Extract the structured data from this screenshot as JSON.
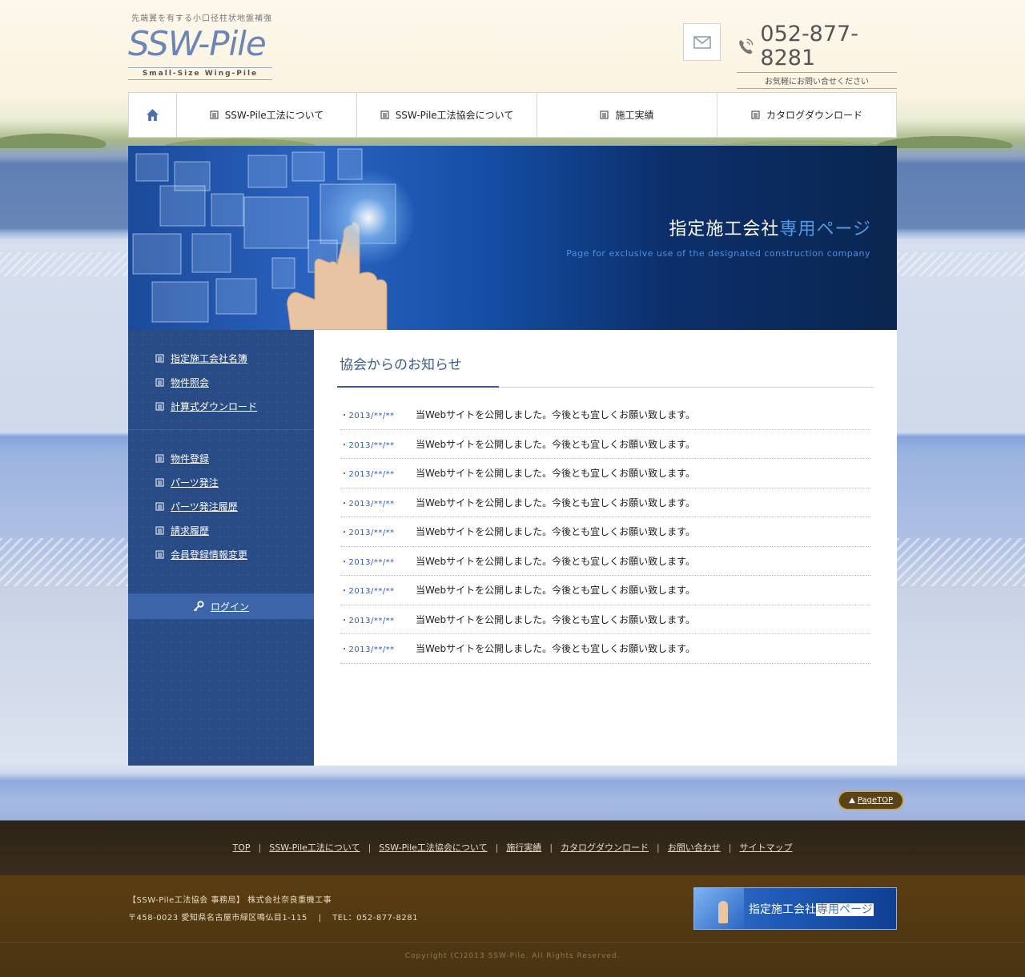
{
  "header": {
    "tagline": "先端翼を有する小口径柱状地盤補強",
    "logo": "SSW-Pile",
    "logo_sub": "Small-Size Wing-Pile",
    "phone": "052-877-8281",
    "phone_note": "お気軽にお問い合せください"
  },
  "nav": {
    "items": [
      {
        "label": "SSW-Pile工法について"
      },
      {
        "label": "SSW-Pile工法協会について"
      },
      {
        "label": "施工実績"
      },
      {
        "label": "カタログダウンロード"
      }
    ]
  },
  "hero": {
    "title_main": "指定施工会社",
    "title_accent": "専用ページ",
    "subtitle": "Page for exclusive use of the designated construction company"
  },
  "sidebar": {
    "group1": [
      {
        "label": "指定施工会社名簿"
      },
      {
        "label": "物件照会"
      },
      {
        "label": "計算式ダウンロード"
      }
    ],
    "group2": [
      {
        "label": "物件登録"
      },
      {
        "label": "パーツ発注"
      },
      {
        "label": "パーツ発注履歴"
      },
      {
        "label": "請求履歴"
      },
      {
        "label": "会員登録情報変更"
      }
    ],
    "login": "ログイン"
  },
  "main": {
    "title": "協会からのお知らせ",
    "news": [
      {
        "date": "・2013/**/**",
        "text": "当Webサイトを公開しました。今後とも宜しくお願い致します。"
      },
      {
        "date": "・2013/**/**",
        "text": "当Webサイトを公開しました。今後とも宜しくお願い致します。"
      },
      {
        "date": "・2013/**/**",
        "text": "当Webサイトを公開しました。今後とも宜しくお願い致します。"
      },
      {
        "date": "・2013/**/**",
        "text": "当Webサイトを公開しました。今後とも宜しくお願い致します。"
      },
      {
        "date": "・2013/**/**",
        "text": "当Webサイトを公開しました。今後とも宜しくお願い致します。"
      },
      {
        "date": "・2013/**/**",
        "text": "当Webサイトを公開しました。今後とも宜しくお願い致します。"
      },
      {
        "date": "・2013/**/**",
        "text": "当Webサイトを公開しました。今後とも宜しくお願い致します。"
      },
      {
        "date": "・2013/**/**",
        "text": "当Webサイトを公開しました。今後とも宜しくお願い致します。"
      },
      {
        "date": "・2013/**/**",
        "text": "当Webサイトを公開しました。今後とも宜しくお願い致します。"
      }
    ]
  },
  "pagetop": "PageTOP",
  "footer": {
    "links": [
      "TOP",
      "SSW-Pile工法について",
      "SSW-Pile工法協会について",
      "施行実績",
      "カタログダウンロード",
      "お問い合わせ",
      "サイトマップ"
    ],
    "separator": "|",
    "office": "【SSW-Pile工法協会 事務局】 株式会社奈良重機工事",
    "address": "〒458-0023 愛知県名古屋市緑区鳴仏目1-115",
    "tel": "TEL：052-877-8281",
    "banner_main": "指定施工会社",
    "banner_accent": "専用ページ",
    "copyright": "Copyright (C)2013 SSW-Pile. All Rights Reserved."
  },
  "colors": {
    "brand_blue": "#3d5c8e",
    "sidebar_bg": "#294b86",
    "date_blue": "#2e5ab5",
    "accent_light_blue": "#4e9be8"
  }
}
